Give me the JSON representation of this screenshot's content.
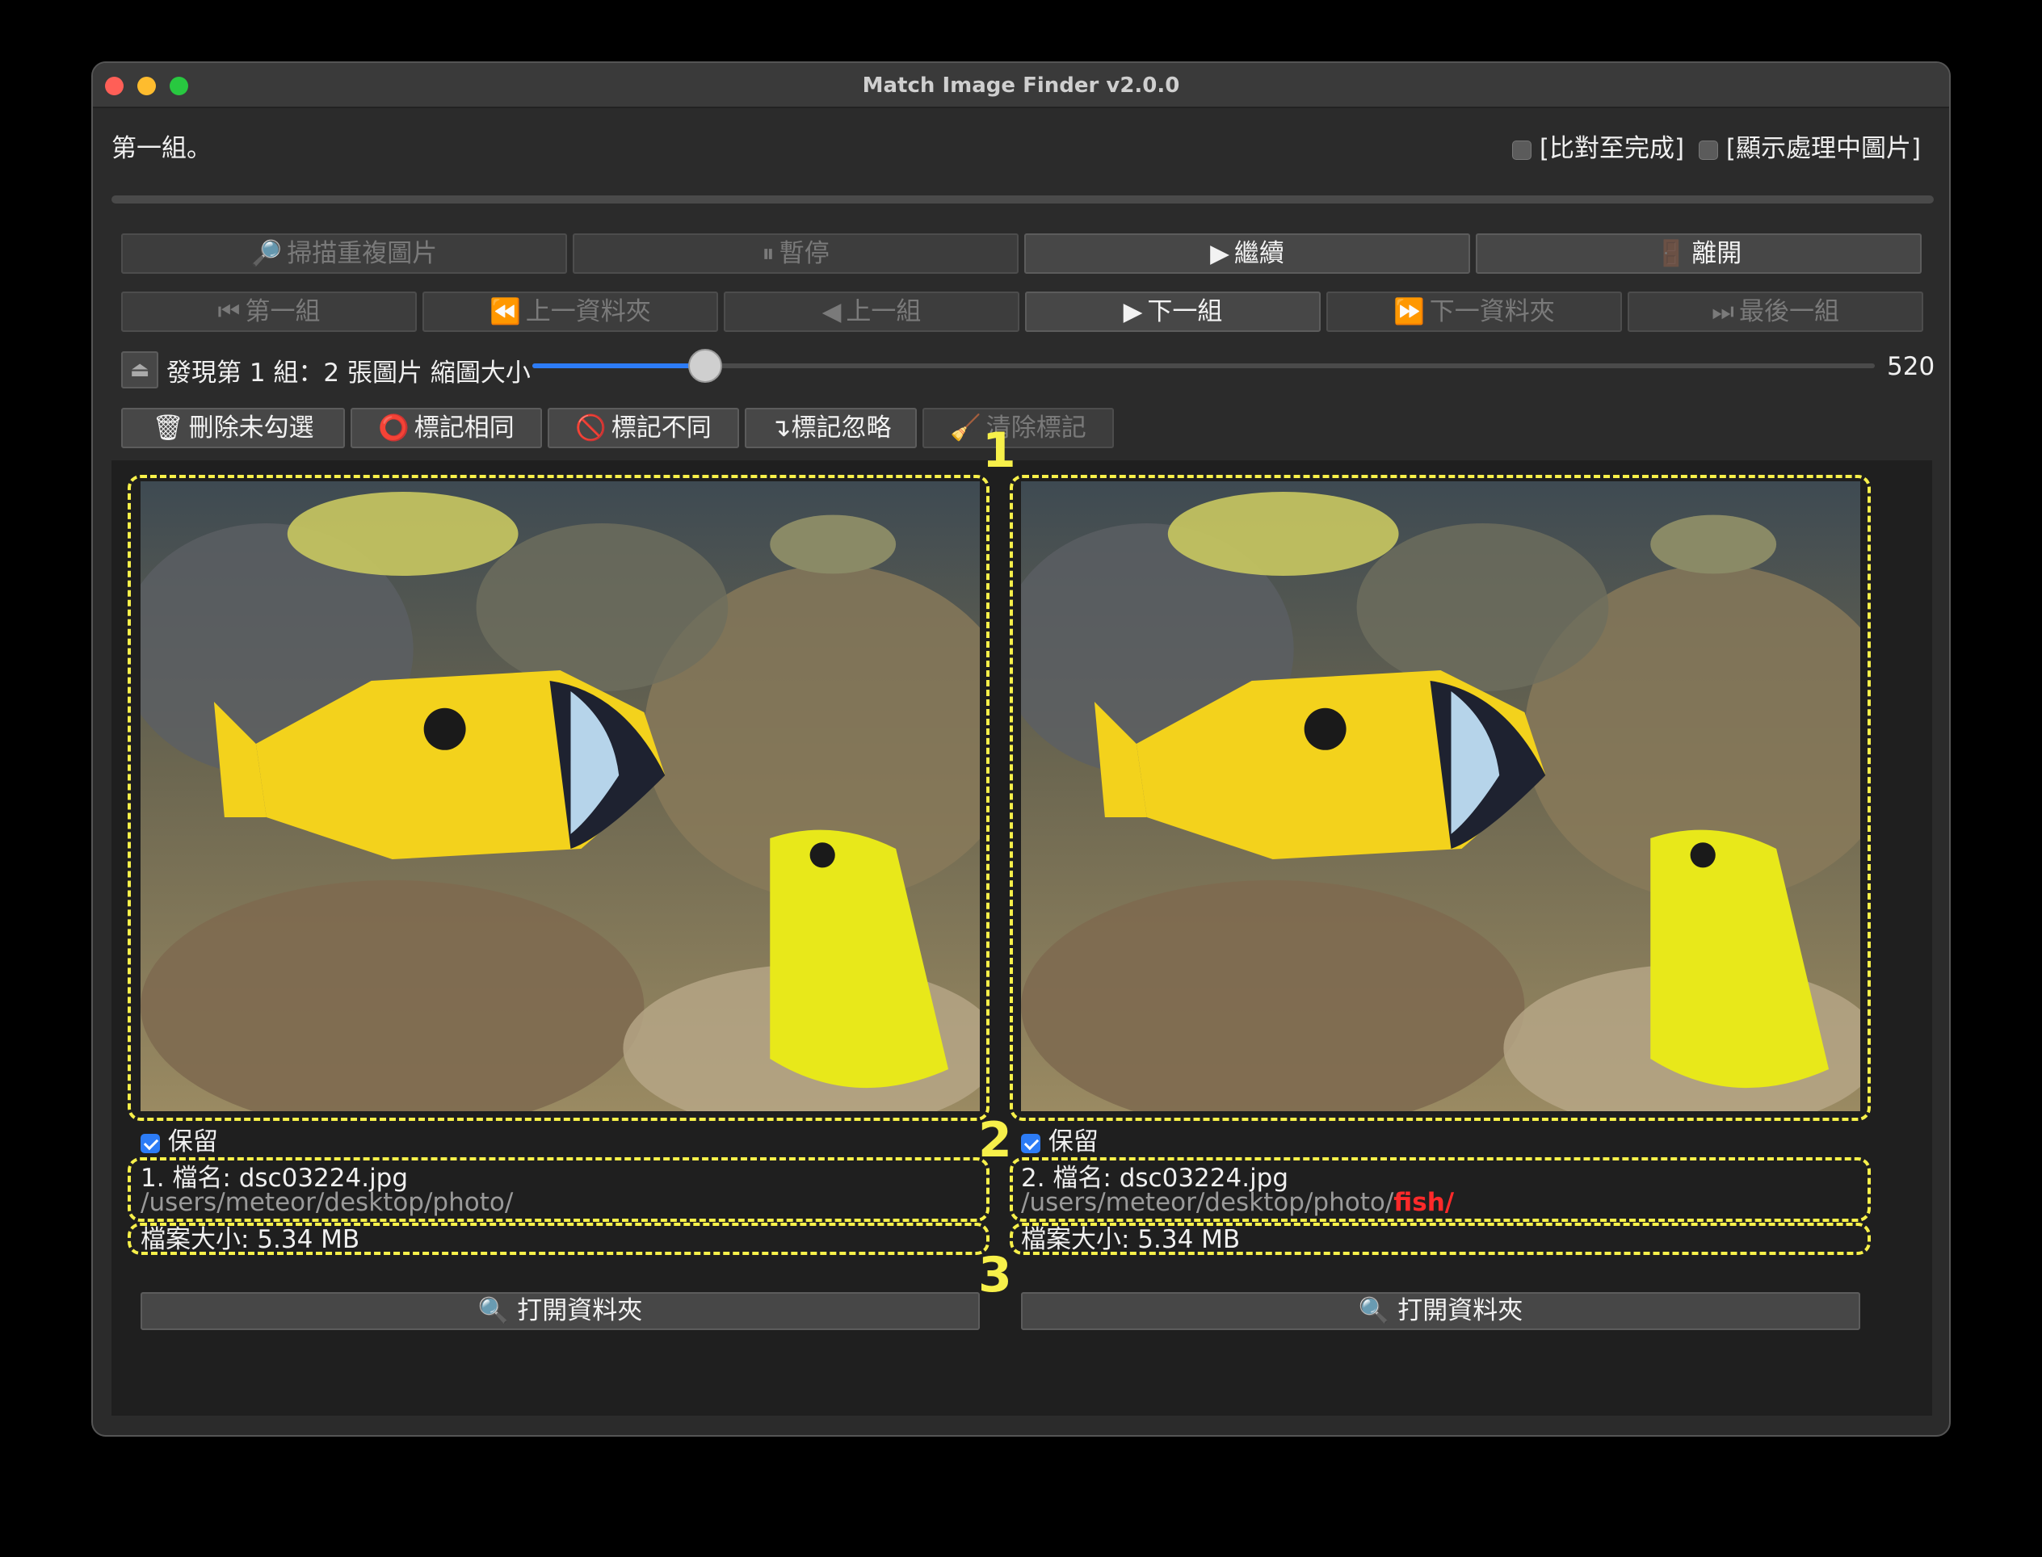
{
  "window": {
    "title": "Match Image Finder v2.0.0"
  },
  "header": {
    "group_label": "第一組。",
    "compare_to_end_label": "[比對至完成]",
    "show_processing_label": "[顯示處理中圖片]",
    "compare_to_end_checked": false,
    "show_processing_checked": false
  },
  "toolbar1": {
    "scan": {
      "icon": "🔎",
      "label": "掃描重複圖片",
      "enabled": false
    },
    "pause": {
      "icon": "⏸",
      "label": "暫停",
      "enabled": false
    },
    "resume": {
      "icon": "▶",
      "label": "繼續",
      "enabled": true
    },
    "exit": {
      "icon": "🚪",
      "label": "離開",
      "enabled": true
    }
  },
  "toolbar2": {
    "first": {
      "icon": "⏮",
      "label": "第一組",
      "enabled": false
    },
    "prev_folder": {
      "icon": "⏪",
      "label": "上一資料夾",
      "enabled": false
    },
    "prev": {
      "icon": "◀",
      "label": "上一組",
      "enabled": false
    },
    "next": {
      "icon": "▶",
      "label": "下一組",
      "enabled": true
    },
    "next_folder": {
      "icon": "⏩",
      "label": "下一資料夾",
      "enabled": false
    },
    "last": {
      "icon": "⏭",
      "label": "最後一組",
      "enabled": false
    }
  },
  "status": {
    "eject_icon": "⏏",
    "found_text": "發現第 1 組：2 張圖片 縮圖大小",
    "slider_value": "520",
    "slider_fraction": 0.129
  },
  "toolbar3": {
    "delete_unchecked": {
      "icon": "🗑",
      "label": "刪除未勾選",
      "enabled": true
    },
    "mark_same": {
      "icon": "⭕",
      "label": "標記相同",
      "enabled": true
    },
    "mark_diff": {
      "icon": "🚫",
      "label": "標記不同",
      "enabled": true
    },
    "mark_ignore": {
      "icon": "↴",
      "label": "標記忽略",
      "enabled": true
    },
    "clear_marks": {
      "icon": "🧹",
      "label": "清除標記",
      "enabled": false
    }
  },
  "annotations": {
    "n1": "1",
    "n2": "2",
    "n3": "3"
  },
  "images": [
    {
      "keep_label": "保留",
      "keep_checked": true,
      "filename_line": "1. 檔名: dsc03224.jpg",
      "path_base": "/users/meteor/desktop/photo/",
      "path_highlight": "",
      "size_line": "檔案大小: 5.34 MB",
      "open_button": {
        "icon": "🔍",
        "label": "打開資料夾"
      }
    },
    {
      "keep_label": "保留",
      "keep_checked": true,
      "filename_line": "2. 檔名: dsc03224.jpg",
      "path_base": "/users/meteor/desktop/photo/",
      "path_highlight": "fish/",
      "size_line": "檔案大小: 5.34 MB",
      "open_button": {
        "icon": "🔍",
        "label": "打開資料夾"
      }
    }
  ],
  "colors": {
    "accent": "#2d7cf6",
    "annotation": "#f7f04a",
    "path_highlight": "#ff2a2a"
  }
}
